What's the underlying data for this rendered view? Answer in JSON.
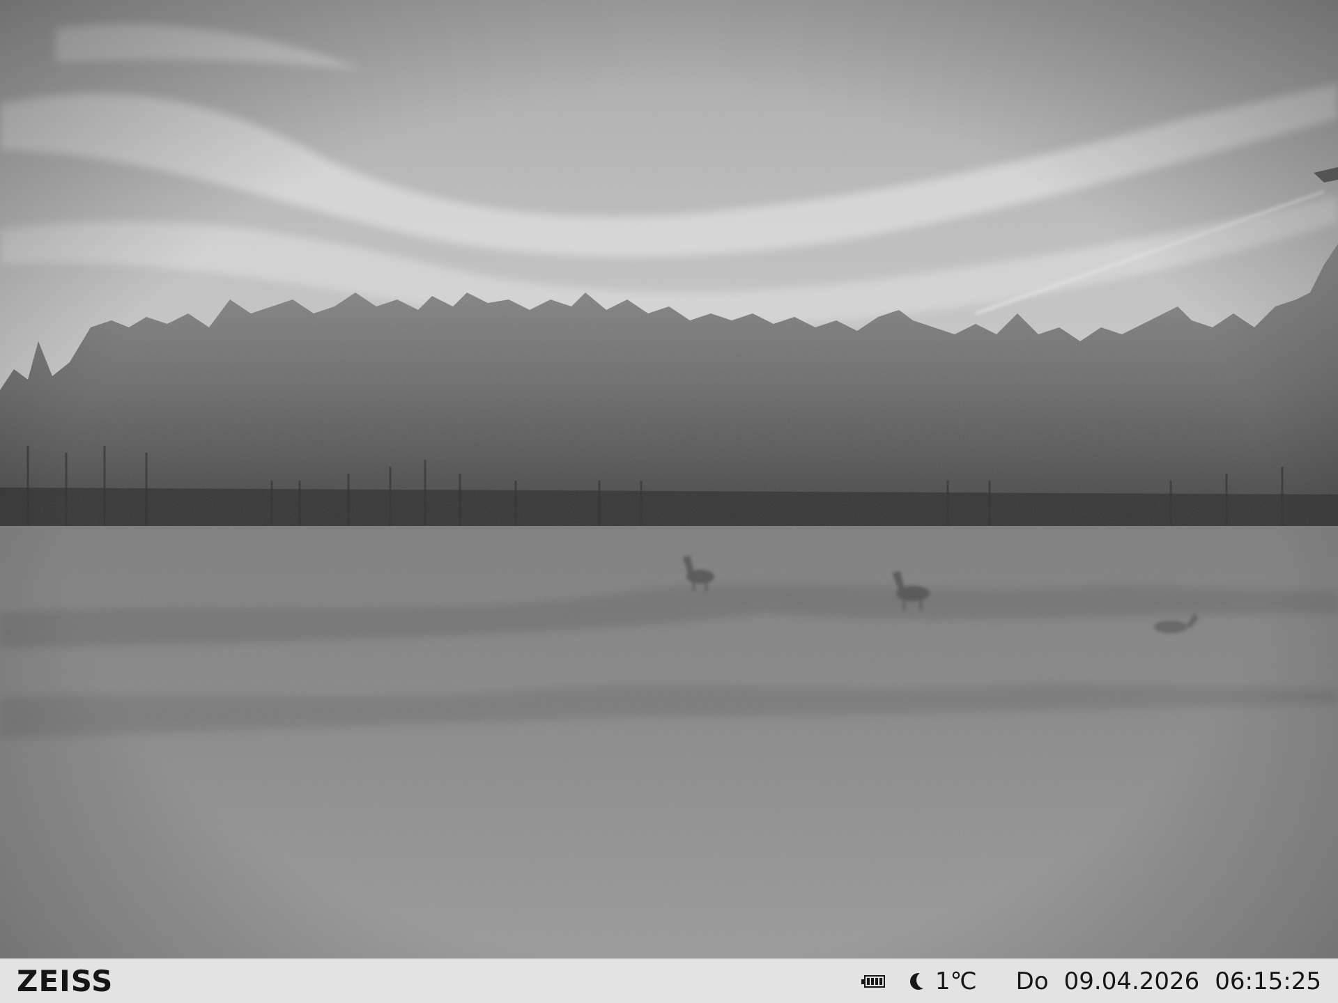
{
  "camera": {
    "brand": "ZEISS",
    "battery_icon": "battery-icon",
    "mode_icon": "moon-icon",
    "temperature": "1℃",
    "weekday": "Do",
    "date": "09.04.2026",
    "time": "06:15:25"
  },
  "scene": {
    "subject_icon": "deer",
    "palette": {
      "sky": "#c9c9c9",
      "forest": "#5a5a5a",
      "meadow": "#8f8f8f",
      "info_bar": "#e3e3e3",
      "info_text": "#161616"
    }
  }
}
